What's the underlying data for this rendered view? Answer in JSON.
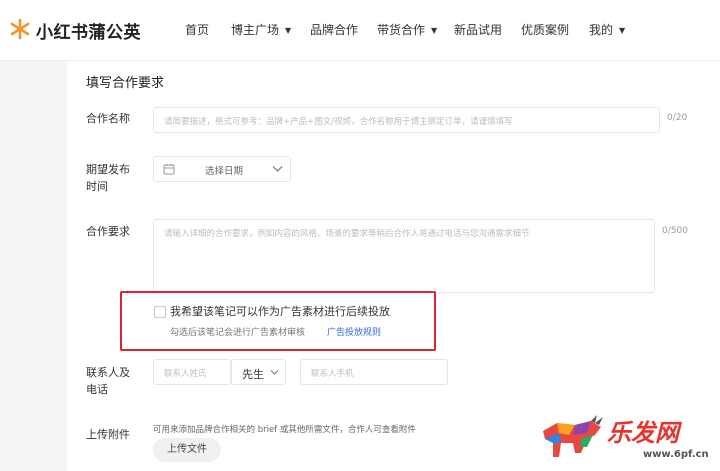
{
  "brand": {
    "name": "小红书蒲公英"
  },
  "nav": [
    {
      "label": "首页",
      "dropdown": false
    },
    {
      "label": "博主广场",
      "dropdown": true
    },
    {
      "label": "品牌合作",
      "dropdown": false
    },
    {
      "label": "带货合作",
      "dropdown": true
    },
    {
      "label": "新品试用",
      "dropdown": false
    },
    {
      "label": "优质案例",
      "dropdown": false
    },
    {
      "label": "我的",
      "dropdown": true
    }
  ],
  "form": {
    "title": "填写合作要求",
    "name": {
      "label": "合作名称",
      "placeholder": "请简要描述，格式可参考：品牌+产品+图文/视频，合作名称用于博主绑定订单，请谨慎填写",
      "counter": "0/20"
    },
    "date": {
      "label_line1": "期望发布",
      "label_line2": "时间",
      "placeholder": "选择日期"
    },
    "requirements": {
      "label": "合作要求",
      "placeholder": "请输入详细的合作要求，例如内容的风格、场景的要求等稍后合作人将通过电话与您沟通需求细节",
      "counter": "0/500"
    },
    "ad_option": {
      "checkbox_label": "我希望该笔记可以作为广告素材进行后续投放",
      "hint": "勾选后该笔记会进行广告素材审核",
      "link": "广告投放规则"
    },
    "contact": {
      "label_line1": "联系人及",
      "label_line2": "电话",
      "name_placeholder": "联系人姓氏",
      "title_value": "先生",
      "phone_placeholder": "联系人手机"
    },
    "upload": {
      "label": "上传附件",
      "hint": "可用来添加品牌合作相关的 brief 或其他所需文件，合作人可查看附件",
      "button": "上传文件"
    }
  },
  "watermark": {
    "text": "乐发网",
    "sub": "www.6pf.cn"
  },
  "colors": {
    "accent": "#e0222e",
    "link": "#2d6cdf",
    "watermark": "#e8332d"
  },
  "icons": [
    "logo-icon",
    "chevron-down-icon",
    "calendar-icon",
    "checkbox-icon",
    "watermark-bull-icon"
  ]
}
